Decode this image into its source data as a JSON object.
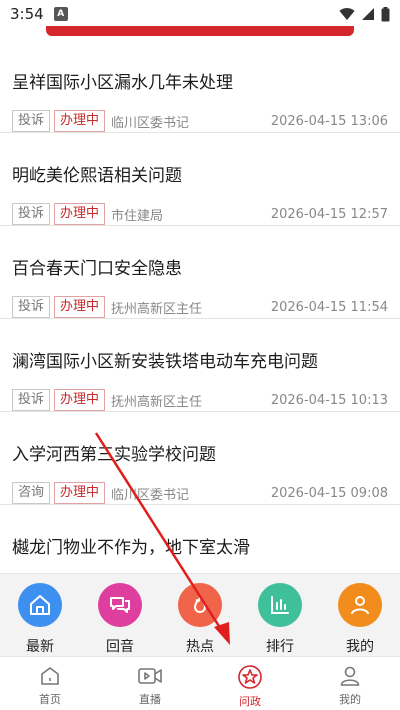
{
  "status_bar": {
    "time": "3:54",
    "app_icon": "A"
  },
  "items": [
    {
      "title": "呈祥国际小区漏水几年未处理",
      "type": "投诉",
      "status": "办理中",
      "dept": "临川区委书记",
      "time": "2026-04-15 13:06"
    },
    {
      "title": "明屹美伦熙语相关问题",
      "type": "投诉",
      "status": "办理中",
      "dept": "市住建局",
      "time": "2026-04-15 12:57"
    },
    {
      "title": "百合春天门口安全隐患",
      "type": "投诉",
      "status": "办理中",
      "dept": "抚州高新区主任",
      "time": "2026-04-15 11:54"
    },
    {
      "title": "澜湾国际小区新安装铁塔电动车充电问题",
      "type": "投诉",
      "status": "办理中",
      "dept": "抚州高新区主任",
      "time": "2026-04-15 10:13"
    },
    {
      "title": "入学河西第三实验学校问题",
      "type": "咨询",
      "status": "办理中",
      "dept": "临川区委书记",
      "time": "2026-04-15 09:08"
    },
    {
      "title": "樾龙门物业不作为，地下室太滑"
    }
  ],
  "quick_bar": [
    {
      "label": "最新",
      "icon": "home-icon",
      "color": "#3d8ff0"
    },
    {
      "label": "回音",
      "icon": "chat-icon",
      "color": "#de3f9e"
    },
    {
      "label": "热点",
      "icon": "flame-icon",
      "color": "#f0654a"
    },
    {
      "label": "排行",
      "icon": "chart-icon",
      "color": "#3fbf9a"
    },
    {
      "label": "我的",
      "icon": "user-icon",
      "color": "#f28c1c"
    }
  ],
  "tabs": [
    {
      "label": "首页",
      "icon": "home-outline-icon"
    },
    {
      "label": "直播",
      "icon": "video-icon"
    },
    {
      "label": "问政",
      "icon": "star-badge-icon",
      "active": true
    },
    {
      "label": "我的",
      "icon": "person-outline-icon"
    }
  ],
  "colors": {
    "accent": "#d4262c"
  }
}
